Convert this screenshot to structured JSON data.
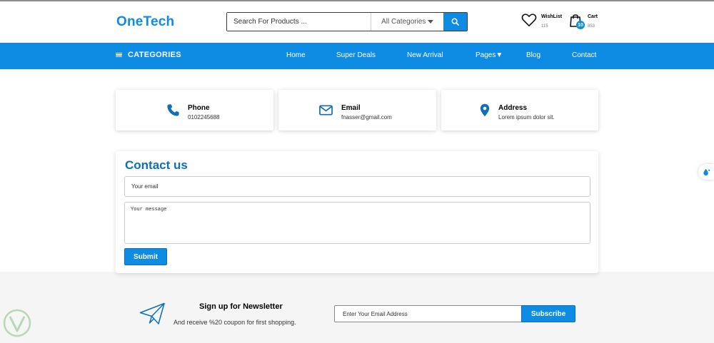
{
  "brand": {
    "name": "OneTech",
    "color": "#0e8ce4"
  },
  "search": {
    "placeholder": "Search For Products ...",
    "category": "All Categories"
  },
  "header": {
    "wishlist": {
      "label": "WishList",
      "count": "115"
    },
    "cart": {
      "label": "Cart",
      "badge": "10",
      "count": "853"
    }
  },
  "nav": {
    "categories_label": "CATEGORIES",
    "items": [
      {
        "label": "Home"
      },
      {
        "label": "Super Deals"
      },
      {
        "label": "New Arrival"
      },
      {
        "label": "Pages▼"
      },
      {
        "label": "Blog"
      },
      {
        "label": "Contact"
      }
    ]
  },
  "info": {
    "phone": {
      "title": "Phone",
      "value": "0102245688",
      "icon": "phone-icon"
    },
    "email": {
      "title": "Email",
      "value": "fnasser@gmail.com",
      "icon": "envelope-icon"
    },
    "address": {
      "title": "Address",
      "value": "Lorem ipsum dolor sit.",
      "icon": "map-pin-icon"
    }
  },
  "contact": {
    "title": "Contact us",
    "email_placeholder": "Your email",
    "message_placeholder": "Your message",
    "submit_label": "Submit"
  },
  "newsletter": {
    "title": "Sign up for Newsletter",
    "subtitle": "And receive %20 coupon for first shopping.",
    "email_placeholder": "Enter Your Email Address",
    "button_label": "Subscribe"
  },
  "colors": {
    "accent": "#0e8ce4",
    "title_blue": "#0e6fb5",
    "footer_bg": "#f5f5f5"
  }
}
